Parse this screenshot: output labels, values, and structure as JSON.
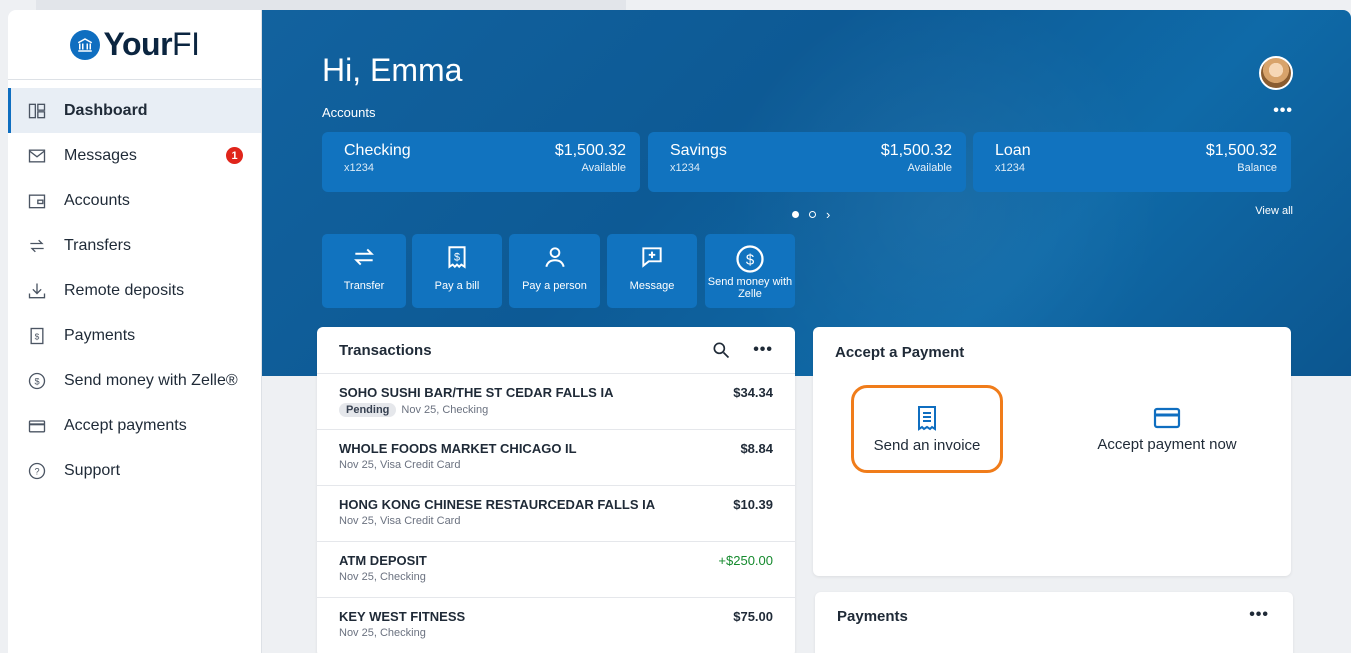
{
  "brand": {
    "name_bold": "Your",
    "name_thin": "FI"
  },
  "sidebar": {
    "items": [
      {
        "label": "Dashboard",
        "icon": "dashboard-icon"
      },
      {
        "label": "Messages",
        "icon": "envelope-icon",
        "badge": "1"
      },
      {
        "label": "Accounts",
        "icon": "wallet-icon"
      },
      {
        "label": "Transfers",
        "icon": "transfer-icon"
      },
      {
        "label": "Remote deposits",
        "icon": "download-icon"
      },
      {
        "label": "Payments",
        "icon": "bill-icon"
      },
      {
        "label": "Send money with Zelle®",
        "icon": "dollar-circle-icon"
      },
      {
        "label": "Accept payments",
        "icon": "credit-card-icon"
      },
      {
        "label": "Support",
        "icon": "question-circle-icon"
      }
    ]
  },
  "hero": {
    "greeting": "Hi, Emma",
    "accounts_label": "Accounts",
    "more": "•••",
    "view_all": "View all",
    "pager_next": "›"
  },
  "accounts": [
    {
      "name": "Checking",
      "number": "x1234",
      "amount": "$1,500.32",
      "sub": "Available"
    },
    {
      "name": "Savings",
      "number": "x1234",
      "amount": "$1,500.32",
      "sub": "Available"
    },
    {
      "name": "Loan",
      "number": "x1234",
      "amount": "$1,500.32",
      "sub": "Balance"
    }
  ],
  "quick_actions": [
    {
      "label": "Transfer",
      "icon": "transfer-icon"
    },
    {
      "label": "Pay a bill",
      "icon": "bill-icon"
    },
    {
      "label": "Pay a person",
      "icon": "person-icon"
    },
    {
      "label": "Message",
      "icon": "message-add-icon"
    },
    {
      "label": "Send money with Zelle",
      "icon": "dollar-circle-icon"
    }
  ],
  "transactions": {
    "title": "Transactions",
    "more": "•••",
    "rows": [
      {
        "desc": "SOHO SUSHI BAR/THE ST CEDAR FALLS IA",
        "pill": "Pending",
        "meta": "Nov 25, Checking",
        "amount": "$34.34"
      },
      {
        "desc": "WHOLE FOODS MARKET CHICAGO IL",
        "meta": "Nov 25, Visa Credit Card",
        "amount": "$8.84"
      },
      {
        "desc": "HONG KONG CHINESE RESTAURCEDAR FALLS IA",
        "meta": "Nov 25, Visa Credit Card",
        "amount": "$10.39"
      },
      {
        "desc": "ATM DEPOSIT",
        "meta": "Nov 25, Checking",
        "amount": "+$250.00",
        "positive": true
      },
      {
        "desc": "KEY WEST FITNESS",
        "meta": "Nov 25, Checking",
        "amount": "$75.00"
      }
    ]
  },
  "accept_payment": {
    "title": "Accept a Payment",
    "send_invoice": "Send an invoice",
    "accept_now": "Accept payment now"
  },
  "payments": {
    "title": "Payments",
    "more": "•••"
  },
  "colors": {
    "primary": "#0f6ec0",
    "hero": "#0d5a95",
    "card": "#1173bf",
    "highlight": "#f07c1a",
    "positive": "#158a2e",
    "badge": "#e0251b"
  }
}
